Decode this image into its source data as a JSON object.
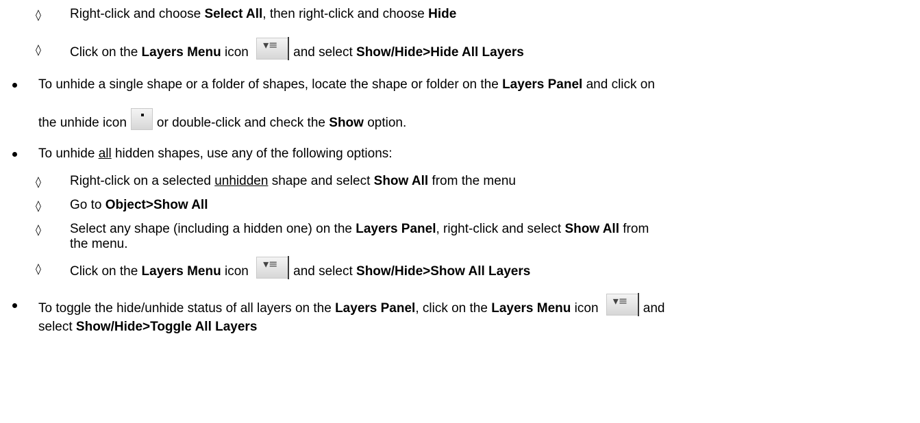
{
  "glyphs": {
    "diamond": "◊",
    "menu_icon_glyph": "▾≡"
  },
  "items": {
    "a1": {
      "pre": "Right-click and choose ",
      "b1": "Select All",
      "mid": ", then right-click and choose ",
      "b2": "Hide"
    },
    "a2": {
      "pre": "Click on the ",
      "b1": "Layers Menu",
      "mid": " icon",
      "post": "and select ",
      "b2": "Show/Hide>Hide All Layers"
    },
    "b": {
      "l1_pre": "To unhide a single shape or a folder of shapes, locate the shape or folder on the ",
      "l1_b": "Layers Panel",
      "l1_post": " and click on",
      "l2_pre": "the unhide icon",
      "l2_mid": "or double-click and check the ",
      "l2_b": "Show",
      "l2_post": " option."
    },
    "c": {
      "pre": "To unhide ",
      "u": "all",
      "post": " hidden shapes, use any of the following options:"
    },
    "c1": {
      "pre": "Right-click on a selected ",
      "u": "unhidden",
      "mid": " shape and select ",
      "b": "Show All",
      "post": " from the menu"
    },
    "c2": {
      "pre": "Go to ",
      "b": "Object>Show All"
    },
    "c3": {
      "l1_pre": "Select any shape (including a hidden one) on the ",
      "l1_b1": "Layers Panel",
      "l1_mid": ", right-click and select ",
      "l1_b2": "Show All",
      "l1_post": " from",
      "l2": "the menu."
    },
    "c4": {
      "pre": "Click on the ",
      "b1": "Layers Menu",
      "mid": " icon",
      "post": "and select ",
      "b2": "Show/Hide>Show All Layers"
    },
    "d": {
      "l1_pre": "To toggle the hide/unhide status of all layers on the ",
      "l1_b1": "Layers Panel",
      "l1_mid": ", click on the ",
      "l1_b2": "Layers Menu",
      "l1_post": " icon",
      "l1_end": "and",
      "l2_pre": "select ",
      "l2_b": "Show/Hide>Toggle All Layers"
    }
  }
}
